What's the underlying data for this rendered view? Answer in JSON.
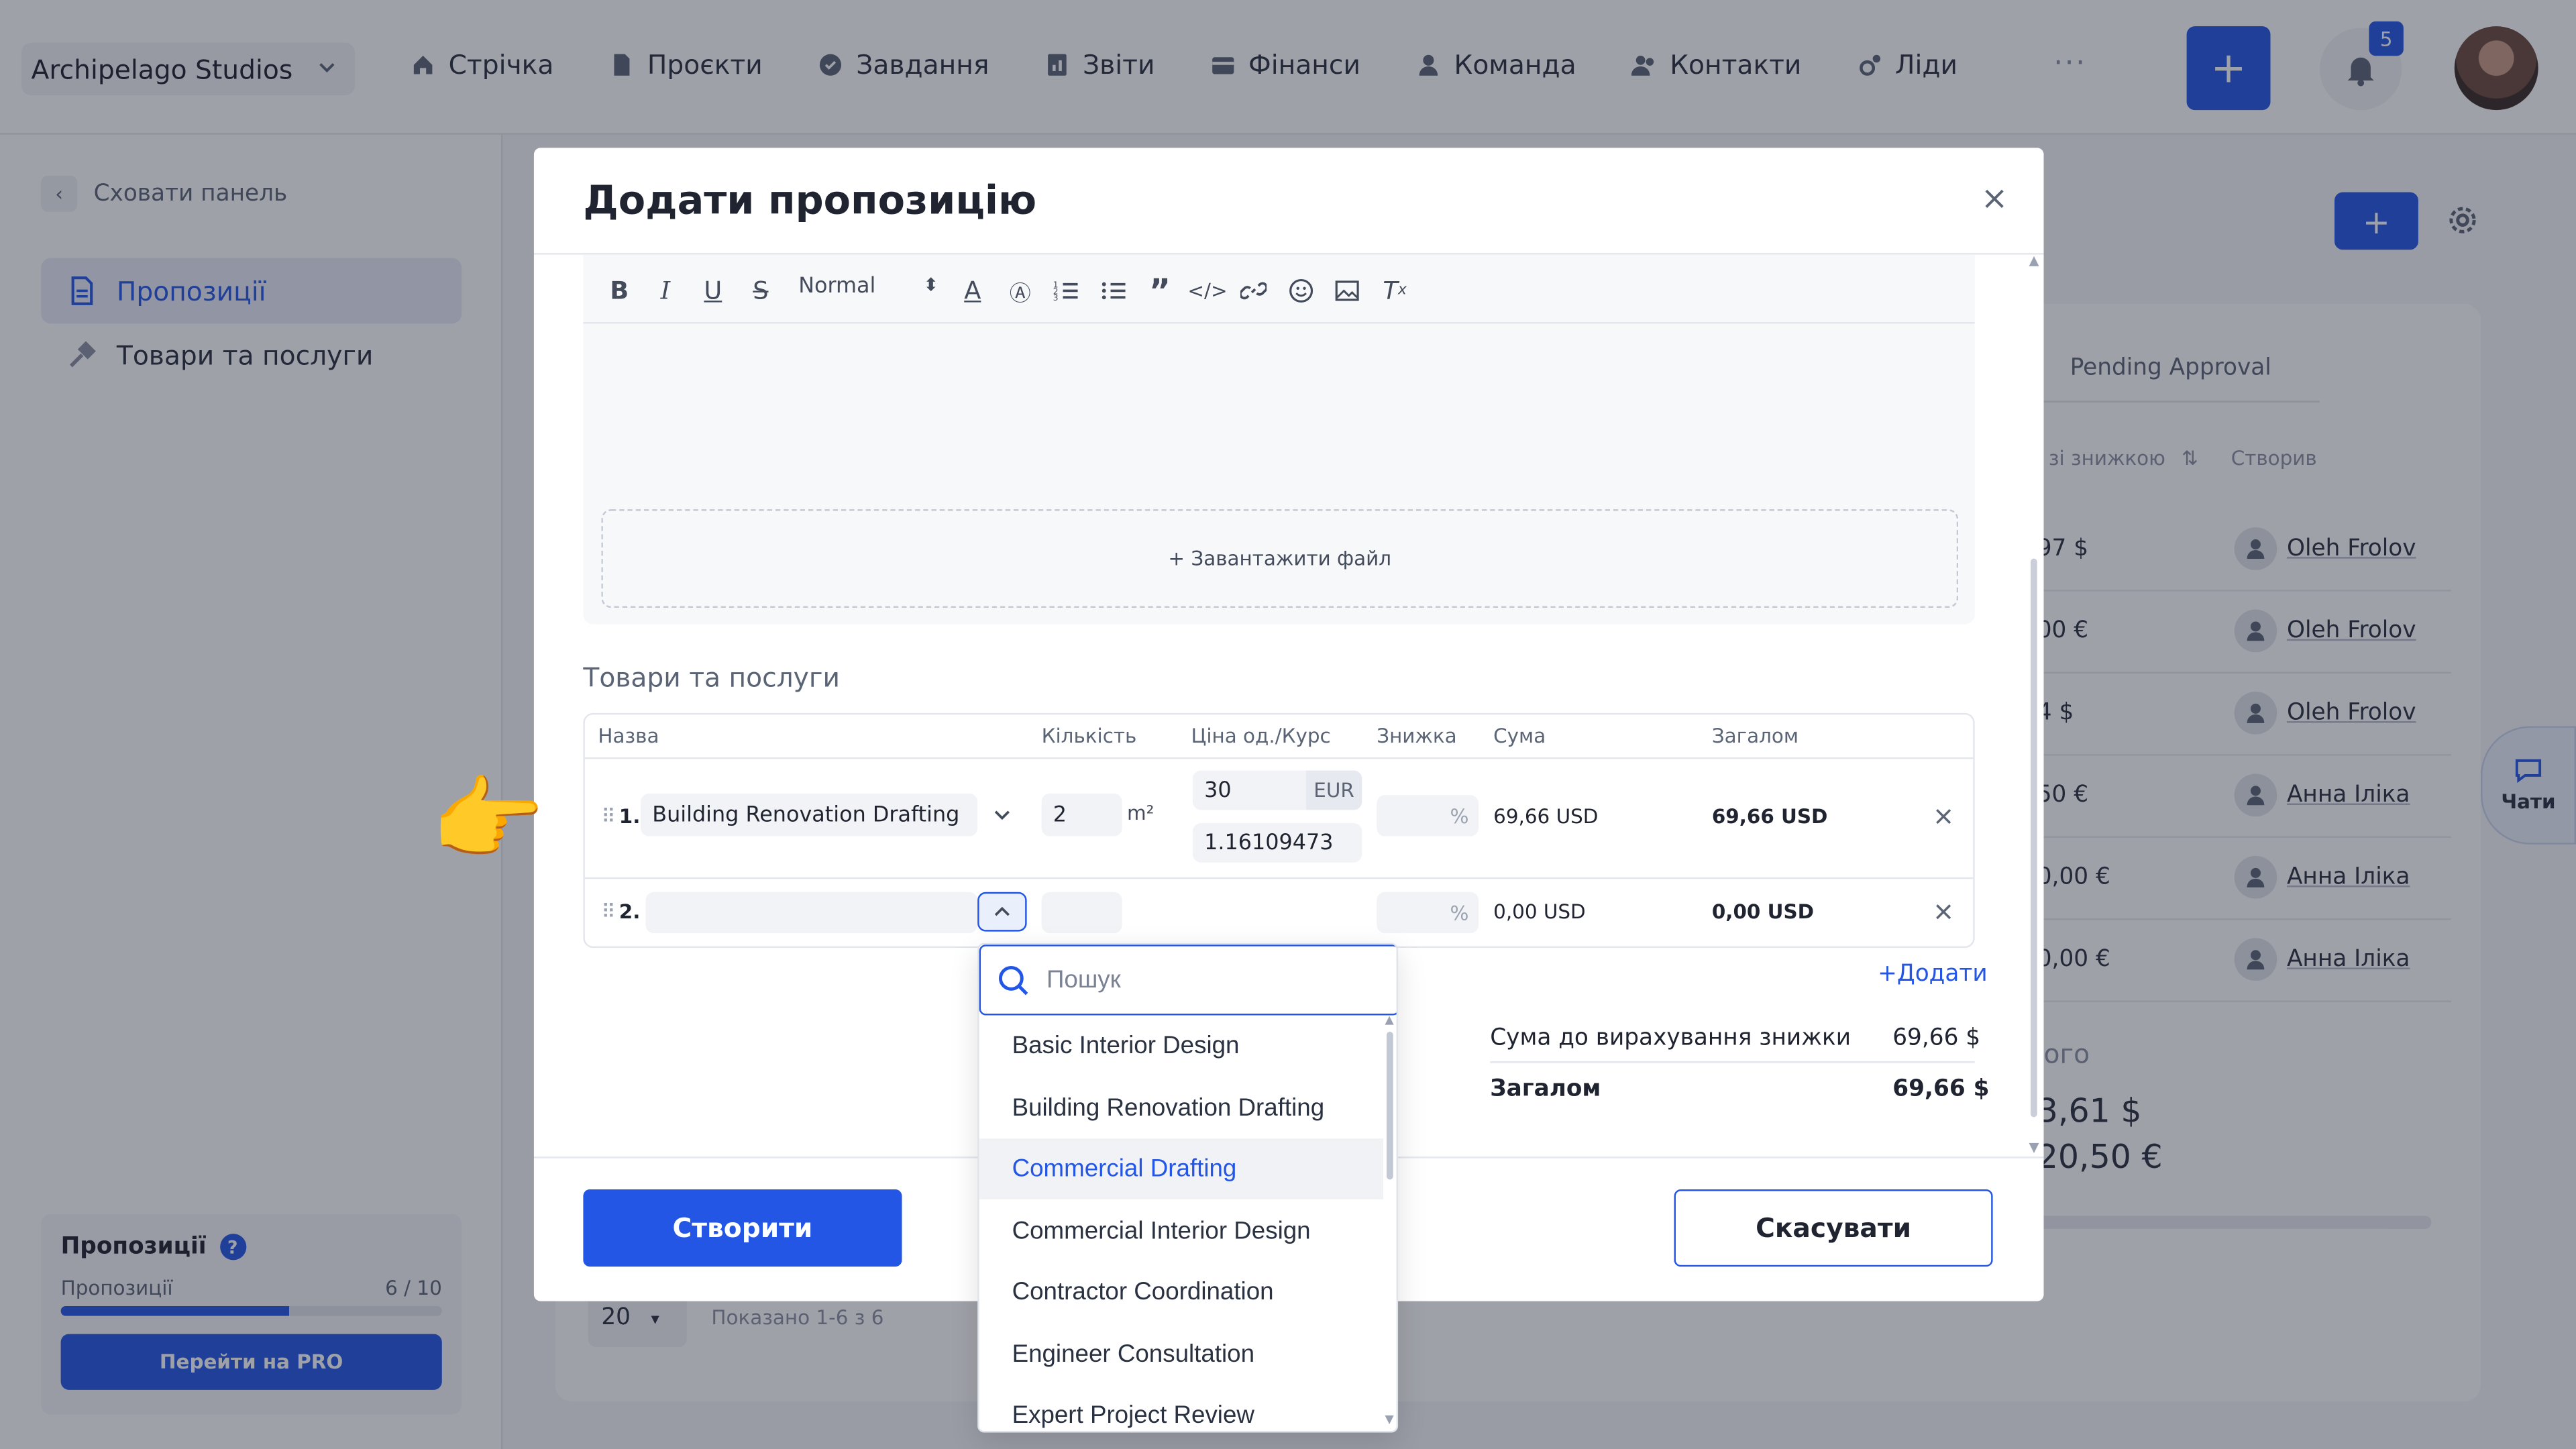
{
  "topbar": {
    "company": "Archipelago Studios",
    "nav": [
      {
        "label": "Стрічка",
        "icon": "home-icon"
      },
      {
        "label": "Проєкти",
        "icon": "document-icon"
      },
      {
        "label": "Завдання",
        "icon": "check-circle-icon"
      },
      {
        "label": "Звіти",
        "icon": "report-icon"
      },
      {
        "label": "Фінанси",
        "icon": "wallet-icon"
      },
      {
        "label": "Команда",
        "icon": "person-icon"
      },
      {
        "label": "Контакти",
        "icon": "contacts-icon"
      },
      {
        "label": "Ліди",
        "icon": "leads-icon"
      }
    ],
    "more": "···",
    "plus": "+",
    "notifications": "5"
  },
  "sidebar": {
    "hide_panel": "Сховати панель",
    "items": [
      {
        "label": "Пропозиції",
        "icon": "document-icon",
        "active": true
      },
      {
        "label": "Товари та послуги",
        "icon": "tools-icon",
        "active": false
      }
    ],
    "card": {
      "title": "Пропозиції",
      "help": "?",
      "usage_label": "Пропозиції",
      "usage": "6 / 10",
      "usage_fraction": 0.6,
      "cta": "Перейти на PRO"
    }
  },
  "background": {
    "tab": "Pending Approval",
    "headers": {
      "discount": "зі знижкою",
      "created_by": "Створив"
    },
    "rows": [
      {
        "amount": "97 $",
        "user": "Oleh Frolov"
      },
      {
        "amount": "00 €",
        "user": "Oleh Frolov"
      },
      {
        "amount": "4 $",
        "user": "Oleh Frolov"
      },
      {
        "amount": "50 €",
        "user": "Анна Іліка"
      },
      {
        "amount": "0,00 €",
        "user": "Анна Іліка"
      },
      {
        "amount": "0,00 €",
        "user": "Анна Іліка"
      }
    ],
    "total_label": "ого",
    "total_usd": "3,61 $",
    "total_eur": "20,50 €",
    "page_size": "20",
    "shown": "Показано 1-6 з 6",
    "chats": "Чати"
  },
  "modal": {
    "title": "Додати пропозицію",
    "editor": {
      "format": "Normal",
      "upload": "+ Завантажити файл"
    },
    "section_title": "Товари та послуги",
    "columns": {
      "name": "Назва",
      "qty": "Кількість",
      "price": "Ціна од./Курс",
      "discount": "Знижка",
      "sum": "Сума",
      "total": "Загалом"
    },
    "items": [
      {
        "num": "1.",
        "name": "Building Renovation Drafting",
        "qty": "2",
        "unit": "m²",
        "price": "30",
        "currency": "EUR",
        "rate": "1.16109473",
        "discount_unit": "%",
        "sum": "69,66 USD",
        "total": "69,66 USD"
      },
      {
        "num": "2.",
        "name": "",
        "qty": "",
        "unit": "",
        "price": "",
        "currency": "",
        "rate": "",
        "discount_unit": "%",
        "sum": "0,00 USD",
        "total": "0,00 USD"
      }
    ],
    "add": "+Додати",
    "summary": {
      "pre_discount_label": "Сума до вирахування знижки",
      "pre_discount_value": "69,66 $",
      "total_label": "Загалом",
      "total_value": "69,66 $"
    },
    "create": "Створити",
    "cancel": "Скасувати"
  },
  "dropdown": {
    "search_placeholder": "Пошук",
    "options": [
      "Basic Interior Design",
      "Building Renovation Drafting",
      "Commercial Drafting",
      "Commercial Interior Design",
      "Contractor Coordination",
      "Engineer Consultation",
      "Expert Project Review"
    ],
    "highlighted": "Commercial Drafting"
  },
  "pointer": "👉",
  "colors": {
    "accent": "#2456e6"
  }
}
